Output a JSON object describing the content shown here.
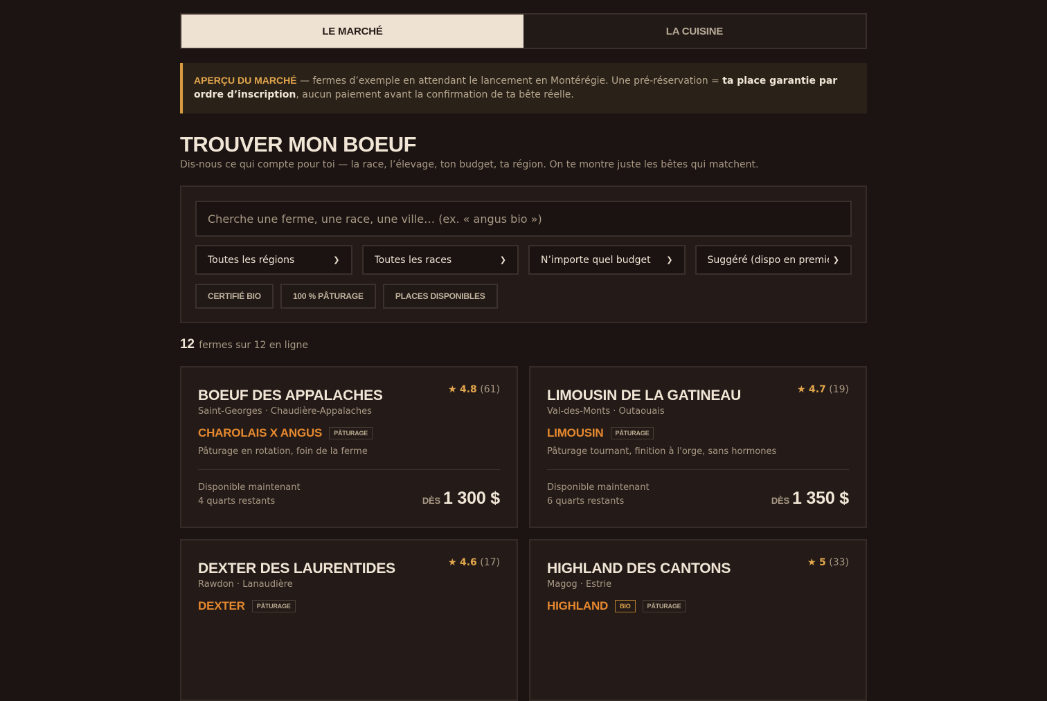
{
  "tabs": [
    {
      "label": "Le marché",
      "active": true
    },
    {
      "label": "La cuisine",
      "active": false
    }
  ],
  "notice": {
    "lead": "Aperçu du marché",
    "text1": " — fermes d’exemple en attendant le lancement en Montérégie. Une pré-réservation = ",
    "bold": "ta place garantie par ordre d’inscription",
    "text2": ", aucun paiement avant la confirmation de ta bête réelle."
  },
  "page": {
    "title": "TROUVER MON BOEUF",
    "subtitle": "Dis-nous ce qui compte pour toi — la race, l’élevage, ton budget, ta région. On te montre juste les bêtes qui matchent."
  },
  "filters": {
    "search_placeholder": "Cherche une ferme, une race, une ville… (ex. « angus bio »)",
    "region": "Toutes les régions",
    "breed": "Toutes les races",
    "budget": "N’importe quel budget",
    "sort": "Suggéré (dispo en premier)",
    "chips": [
      "Certifié bio",
      "100 % pâturage",
      "Places disponibles"
    ]
  },
  "results": {
    "count": "12",
    "text": "fermes sur 12 en ligne"
  },
  "farms": [
    {
      "name": "Boeuf des Appalaches",
      "rating": "4.8",
      "reviews": "(61)",
      "location": "Saint-Georges · Chaudière-Appalaches",
      "breed": "Charolais x Angus",
      "badges": [
        "Pâturage"
      ],
      "description": "Pâturage en rotation, foin de la ferme",
      "availability": "Disponible maintenant",
      "remaining": "4 quarts restants",
      "price_prefix": "Dès",
      "price": "1 300 $"
    },
    {
      "name": "Limousin de la Gatineau",
      "rating": "4.7",
      "reviews": "(19)",
      "location": "Val-des-Monts · Outaouais",
      "breed": "Limousin",
      "badges": [
        "Pâturage"
      ],
      "description": "Pâturage tournant, finition à l'orge, sans hormones",
      "availability": "Disponible maintenant",
      "remaining": "6 quarts restants",
      "price_prefix": "Dès",
      "price": "1 350 $"
    },
    {
      "name": "Dexter des Laurentides",
      "rating": "4.6",
      "reviews": "(17)",
      "location": "Rawdon · Lanaudière",
      "breed": "Dexter",
      "badges": [
        "Pâturage"
      ],
      "description": "",
      "availability": "",
      "remaining": "",
      "price_prefix": "",
      "price": ""
    },
    {
      "name": "Highland des Cantons",
      "rating": "5",
      "reviews": "(33)",
      "location": "Magog · Estrie",
      "breed": "Highland",
      "badges": [
        "Bio",
        "Pâturage"
      ],
      "description": "",
      "availability": "",
      "remaining": "",
      "price_prefix": "",
      "price": ""
    }
  ],
  "colors": {
    "background": "#1b1412",
    "accent_orange": "#e7892e",
    "accent_gold": "#e2a64c",
    "text_light": "#f1e6d6"
  }
}
